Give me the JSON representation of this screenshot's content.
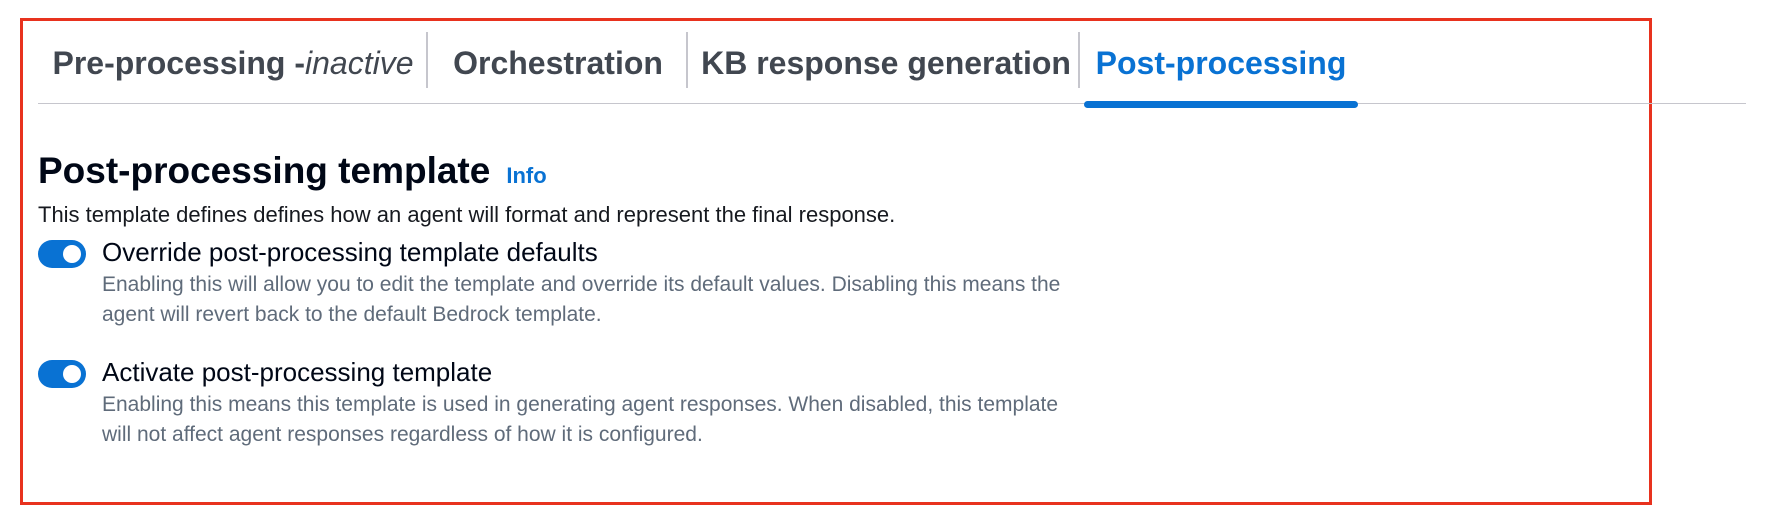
{
  "tabs": [
    {
      "label": "Pre-processing - ",
      "suffix": "inactive",
      "active": false
    },
    {
      "label": "Orchestration",
      "active": false
    },
    {
      "label": "KB response generation",
      "active": false
    },
    {
      "label": "Post-processing",
      "active": true
    }
  ],
  "section": {
    "title": "Post-processing template",
    "info_label": "Info",
    "description": "This template defines defines how an agent will format and represent the final response."
  },
  "toggles": [
    {
      "label": "Override post-processing template defaults",
      "help": "Enabling this will allow you to edit the template and override its default values. Disabling this means the agent will revert back to the default Bedrock template.",
      "checked": true
    },
    {
      "label": "Activate post-processing template",
      "help": "Enabling this means this template is used in generating agent responses. When disabled, this template will not affect agent responses regardless of how it is configured.",
      "checked": true
    }
  ],
  "colors": {
    "accent": "#0972d3",
    "highlight_border": "#e8321e"
  }
}
